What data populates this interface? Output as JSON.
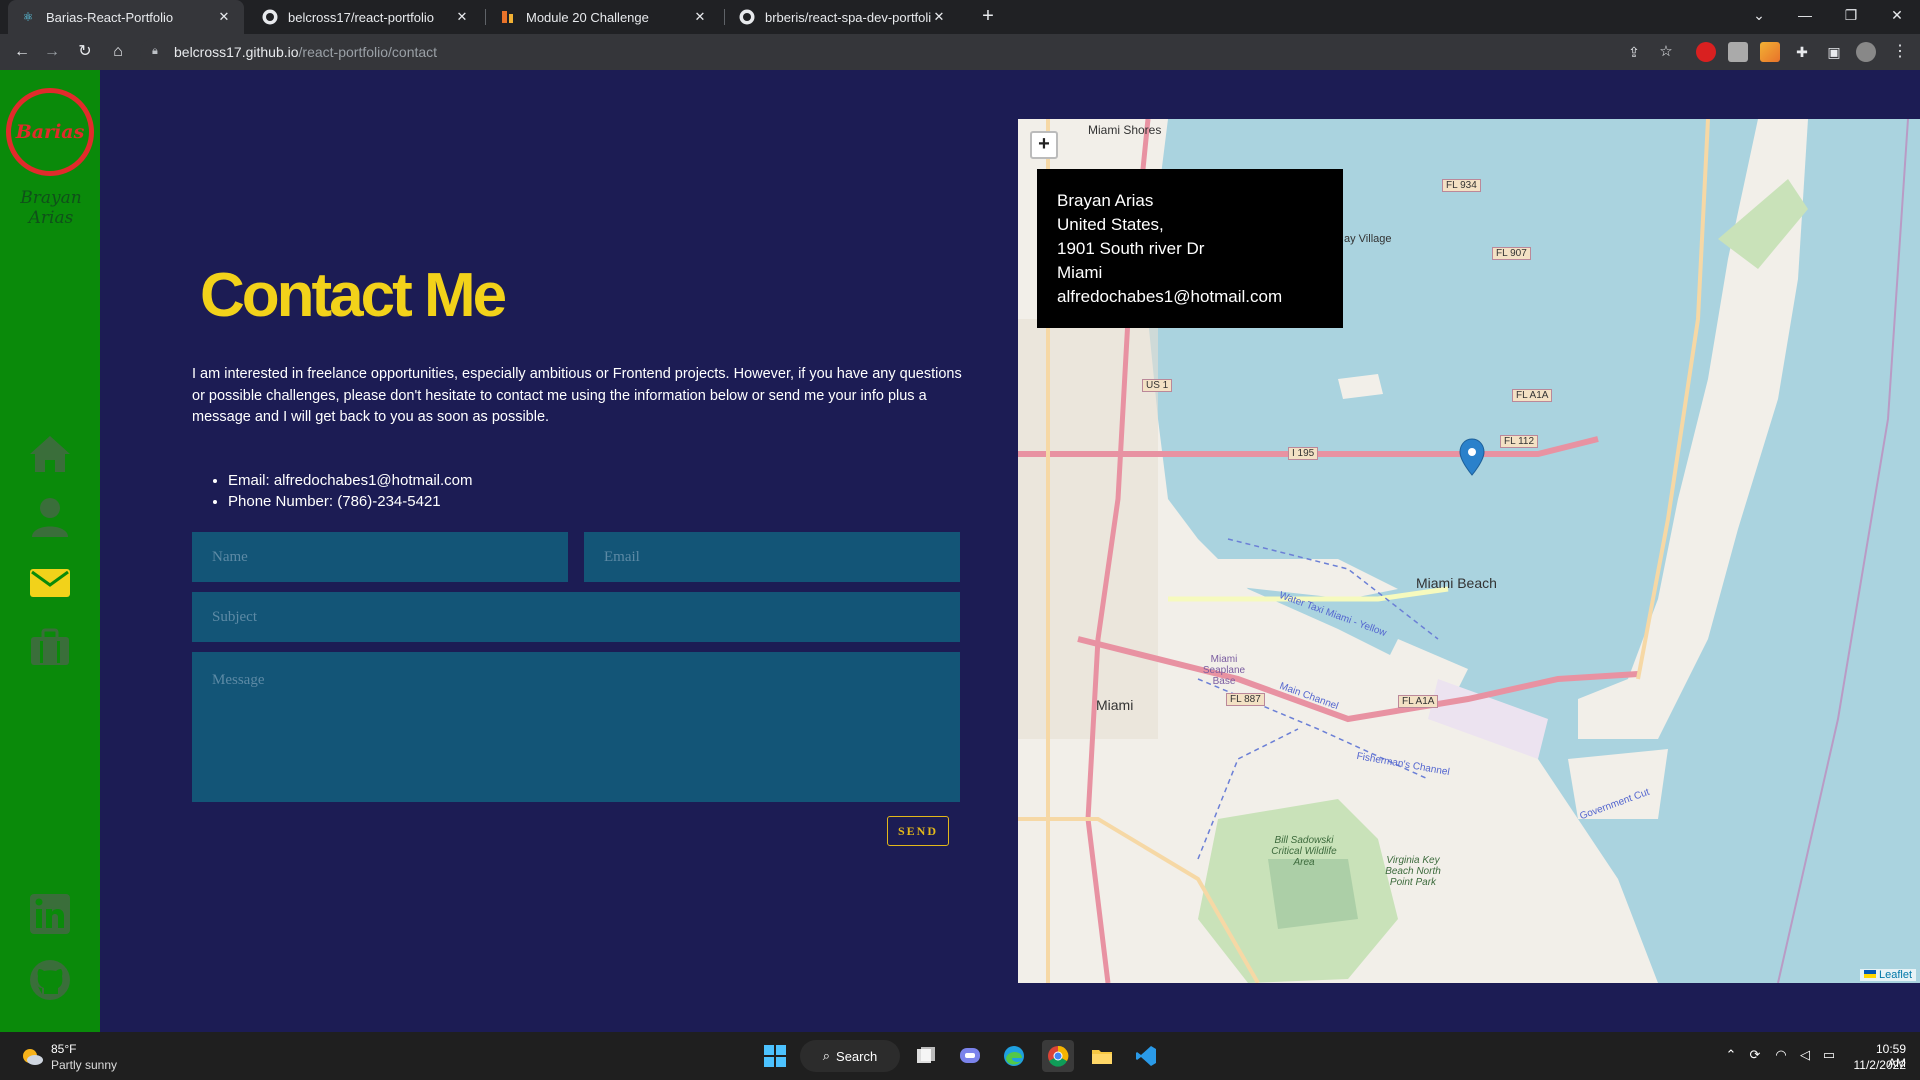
{
  "browser": {
    "tabs": [
      {
        "title": "Barias-React-Portfolio",
        "icon": "react-icon",
        "active": true
      },
      {
        "title": "belcross17/react-portfolio",
        "icon": "github-icon",
        "active": false
      },
      {
        "title": "Module 20 Challenge",
        "icon": "bootcamp-icon",
        "active": false
      },
      {
        "title": "brberis/react-spa-dev-portfolio-",
        "icon": "github-icon",
        "active": false
      }
    ],
    "url_host": "belcross17.github.io",
    "url_path": "/react-portfolio/contact"
  },
  "sidebar": {
    "logo_text": "Barias",
    "signature": "Brayan Arias",
    "nav_icons": [
      "home-icon",
      "user-icon",
      "mail-icon",
      "briefcase-icon"
    ],
    "social_icons": [
      "linkedin-icon",
      "github-icon"
    ],
    "active_color": "#f2d21a",
    "inactive_color": "#3a6e3a"
  },
  "contact": {
    "title": "Contact Me",
    "intro": "I am interested in freelance opportunities, especially ambitious or Frontend projects. However, if you have any questions or possible challenges, please don't hesitate to contact me using the information below or send me your info plus a message and I will get back to you as soon as possible.",
    "email_line": "Email: alfredochabes1@hotmail.com",
    "phone_line": "Phone Number: (786)-234-5421",
    "form": {
      "name_placeholder": "Name",
      "email_placeholder": "Email",
      "subject_placeholder": "Subject",
      "message_placeholder": "Message",
      "send_label": "SEND"
    }
  },
  "map": {
    "zoom_in_label": "+",
    "popup": {
      "name": "Brayan Arias",
      "country": "United States,",
      "street": "1901 South river Dr",
      "city": "Miami",
      "email": "alfredochabes1@hotmail.com"
    },
    "labels": {
      "miami_shores": "Miami Shores",
      "bay_village": "ay Village",
      "miami_beach": "Miami Beach",
      "miami": "Miami",
      "seaplane": "Miami Seaplane Base",
      "water_taxi": "Water Taxi Miami - Yellow",
      "main_channel": "Main Channel",
      "fisherman": "Fisherman's Channel",
      "bill_baggs": "Bill Sadowski Critical Wildlife Area",
      "virginia_key": "Virginia Key Beach North Point Park",
      "gov_cut": "Government Cut"
    },
    "roads": [
      "FL 934",
      "FL 907",
      "US 1",
      "FL A1A",
      "I 195",
      "FL 112",
      "FL 887",
      "FL A1A"
    ],
    "attribution": "Leaflet"
  },
  "taskbar": {
    "temperature": "85°F",
    "weather": "Partly sunny",
    "search_label": "Search",
    "time": "10:59 AM",
    "date": "11/2/2022"
  }
}
